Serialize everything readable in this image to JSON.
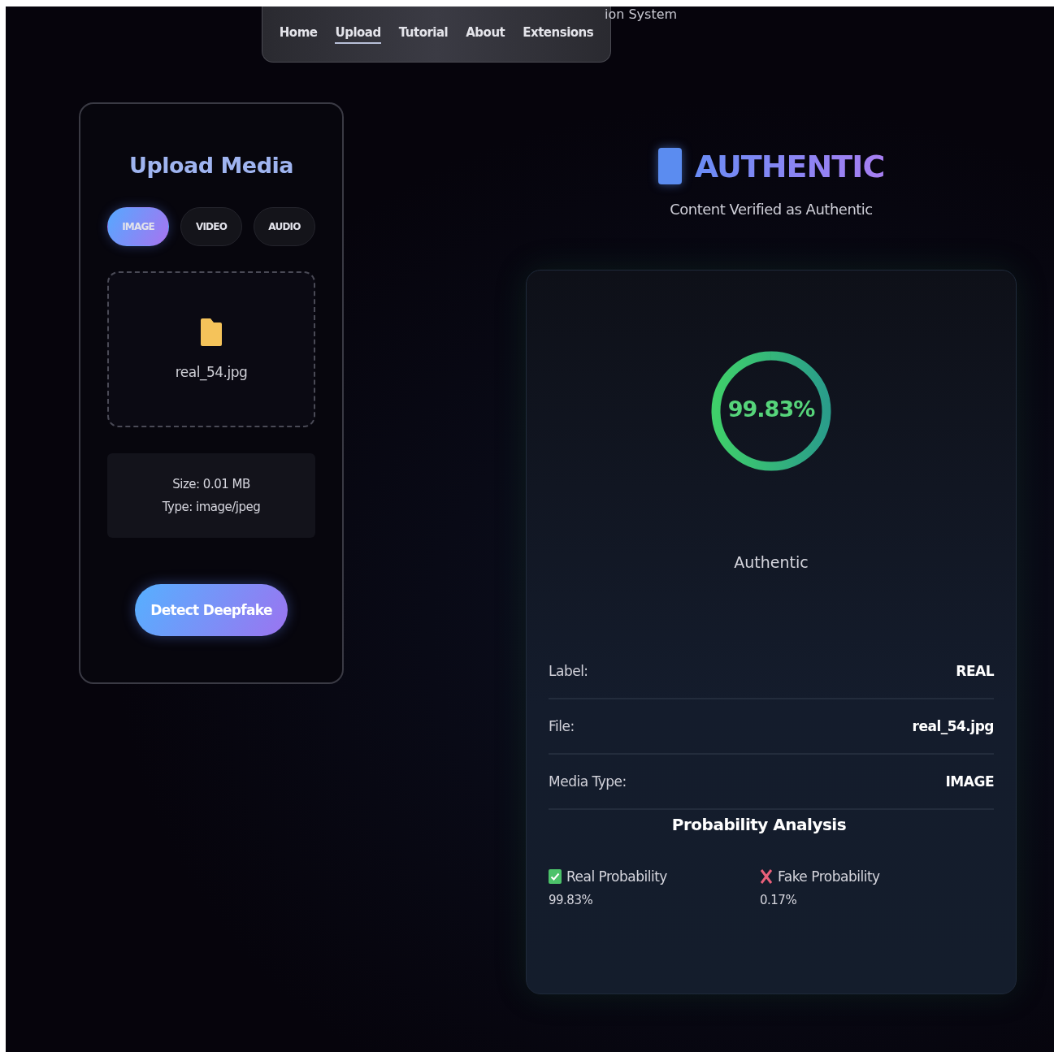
{
  "header_text": "ion System",
  "nav": [
    {
      "label": "Home",
      "selected": false
    },
    {
      "label": "Upload",
      "selected": true
    },
    {
      "label": "Tutorial",
      "selected": false
    },
    {
      "label": "About",
      "selected": false
    },
    {
      "label": "Extensions",
      "selected": false
    }
  ],
  "upload": {
    "title": "Upload Media",
    "media_tabs": [
      {
        "label": "IMAGE",
        "selected": true
      },
      {
        "label": "VIDEO",
        "selected": false
      },
      {
        "label": "AUDIO",
        "selected": false
      }
    ],
    "file_name": "real_54.jpg",
    "info": [
      "Size: 0.01 MB",
      "Type: image/jpeg"
    ],
    "button": "Detect Deepfake"
  },
  "verdict": {
    "title": "AUTHENTIC",
    "subtitle": "Content Verified as Authentic"
  },
  "result": {
    "score": "99.83%",
    "level": 0.9983,
    "score_label": "Authentic",
    "details": [
      {
        "label": "Label:",
        "value": "REAL"
      },
      {
        "label": "File:",
        "value": "real_54.jpg"
      },
      {
        "label": "Media Type:",
        "value": "IMAGE"
      }
    ],
    "probability_title": "Probability Analysis",
    "probabilities": [
      {
        "kind": "real",
        "label": "Real Probability",
        "value": "99.83%"
      },
      {
        "kind": "fake",
        "label": "Fake Probability",
        "value": "0.17%"
      }
    ]
  }
}
